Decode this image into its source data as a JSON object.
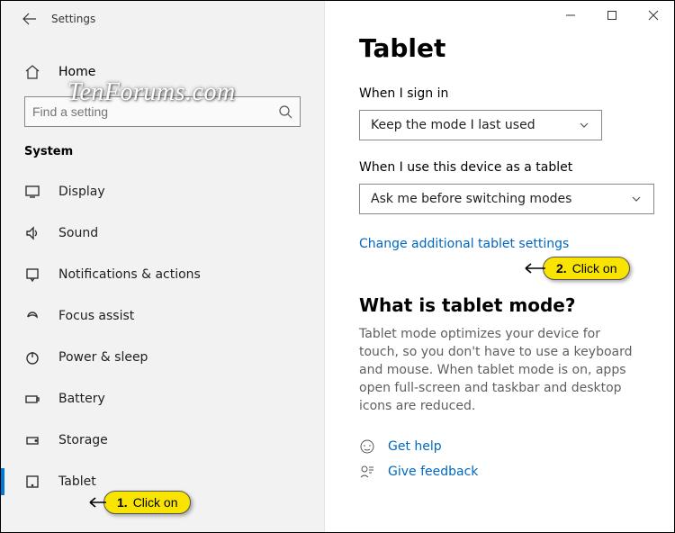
{
  "window": {
    "title": "Settings"
  },
  "sidebar": {
    "home_label": "Home",
    "search_placeholder": "Find a setting",
    "section_label": "System",
    "items": [
      {
        "label": "Display",
        "icon": "display"
      },
      {
        "label": "Sound",
        "icon": "sound"
      },
      {
        "label": "Notifications & actions",
        "icon": "notifications"
      },
      {
        "label": "Focus assist",
        "icon": "focus-assist"
      },
      {
        "label": "Power & sleep",
        "icon": "power"
      },
      {
        "label": "Battery",
        "icon": "battery"
      },
      {
        "label": "Storage",
        "icon": "storage"
      },
      {
        "label": "Tablet",
        "icon": "tablet"
      }
    ]
  },
  "main": {
    "page_title": "Tablet",
    "signin_label": "When I sign in",
    "signin_value": "Keep the mode I last used",
    "device_label": "When I use this device as a tablet",
    "device_value": "Ask me before switching modes",
    "change_link": "Change additional tablet settings",
    "info_heading": "What is tablet mode?",
    "info_body": "Tablet mode optimizes your device for touch, so you don't have to use a keyboard and mouse. When tablet mode is on, apps open full-screen and taskbar and desktop icons are reduced.",
    "help_link": "Get help",
    "feedback_link": "Give feedback"
  },
  "annotations": {
    "watermark": "TenForums.com",
    "callout1_num": "1.",
    "callout1_text": "Click on",
    "callout2_num": "2.",
    "callout2_text": "Click on"
  }
}
